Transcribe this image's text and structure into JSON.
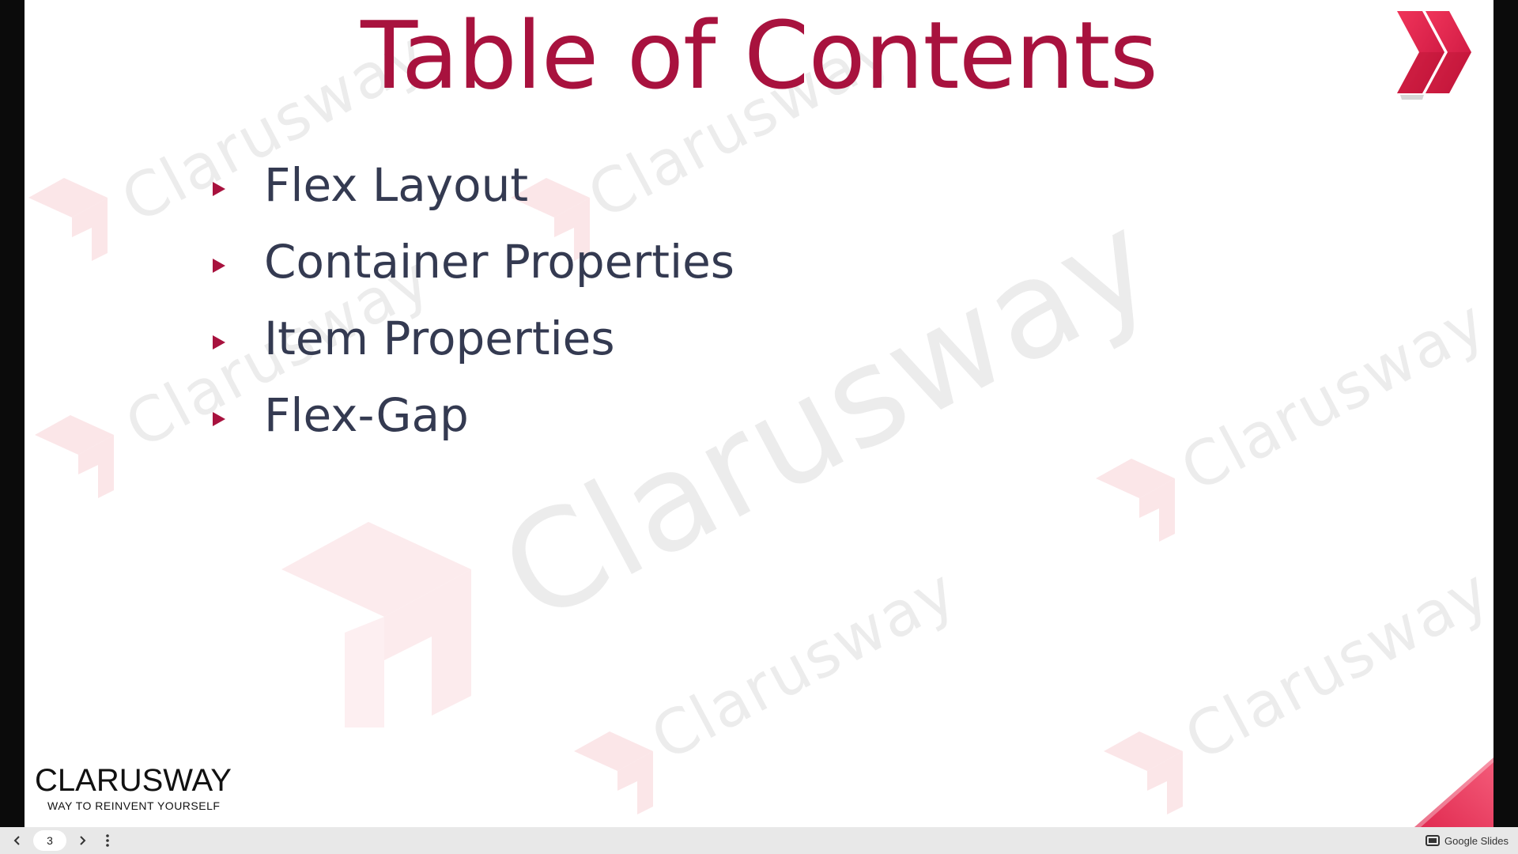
{
  "slide": {
    "title": "Table of Contents",
    "toc_items": [
      {
        "label": "Flex Layout"
      },
      {
        "label": "Container Properties"
      },
      {
        "label": "Item Properties"
      },
      {
        "label": "Flex-Gap"
      }
    ],
    "watermark_text": "Clarusway",
    "brand": {
      "name": "CLARUSWAY",
      "tagline": "WAY TO REINVENT YOURSELF"
    },
    "colors": {
      "accent": "#a8123e",
      "text": "#343a51",
      "watermark": "#ececec"
    }
  },
  "toolbar": {
    "current_page": "3",
    "prev_icon": "chevron-left-icon",
    "next_icon": "chevron-right-icon",
    "more_icon": "more-vertical-icon",
    "app_label": "Google Slides"
  }
}
